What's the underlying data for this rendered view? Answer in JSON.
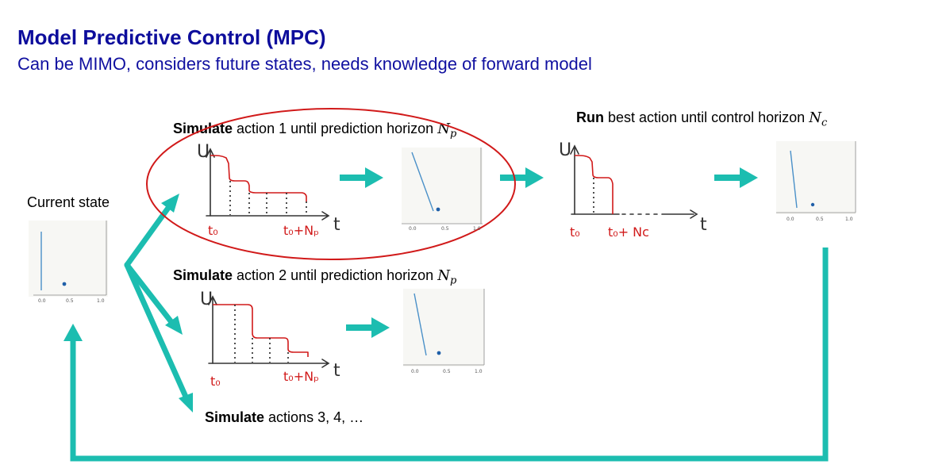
{
  "header": {
    "title": "Model Predictive Control (MPC)",
    "subtitle": "Can be MIMO, considers future states, needs knowledge of forward model"
  },
  "current_state": {
    "label": "Current state"
  },
  "action1": {
    "verb": "Simulate",
    "text": "action 1 until prediction horizon",
    "horizon": "N",
    "horizon_sub": "p"
  },
  "action2": {
    "verb": "Simulate",
    "text": "action 2 until prediction horizon",
    "horizon": "N",
    "horizon_sub": "p"
  },
  "action3": {
    "verb": "Simulate",
    "text": "actions 3, 4, …"
  },
  "run": {
    "verb": "Run",
    "text": "best action until control horizon",
    "horizon": "N",
    "horizon_sub": "c"
  },
  "sketch": {
    "u": "U",
    "t": "t",
    "t0": "t₀",
    "t_np": "t₀+Nₚ",
    "t_nc": "t₀+ Nc"
  },
  "plot_ticks": [
    "0.0",
    "0.5",
    "1.0"
  ],
  "colors": {
    "title": "#0d0d9c",
    "arrow": "#1cbdb0",
    "highlight": "#d11a1a",
    "line": "#4a90c8",
    "point": "#1f5fa8"
  }
}
